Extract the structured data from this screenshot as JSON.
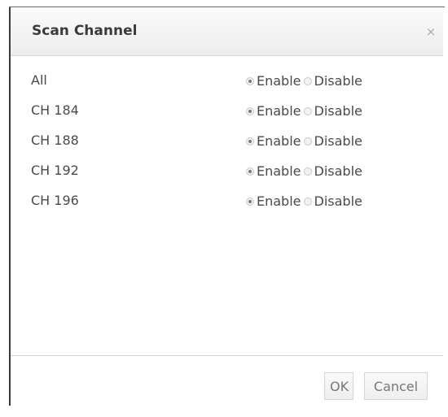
{
  "dialog": {
    "title": "Scan Channel",
    "close_label": "×"
  },
  "channels": [
    {
      "label": "All",
      "selected": "Enable"
    },
    {
      "label": "CH 184",
      "selected": "Enable"
    },
    {
      "label": "CH 188",
      "selected": "Enable"
    },
    {
      "label": "CH 192",
      "selected": "Enable"
    },
    {
      "label": "CH 196",
      "selected": "Enable"
    }
  ],
  "options": {
    "enable_label": "Enable",
    "disable_label": "Disable"
  },
  "footer": {
    "ok_label": "OK",
    "cancel_label": "Cancel"
  },
  "colors": {
    "title_text": "#3a3a3a",
    "body_text": "#4a4a4a",
    "button_text": "#777777"
  }
}
